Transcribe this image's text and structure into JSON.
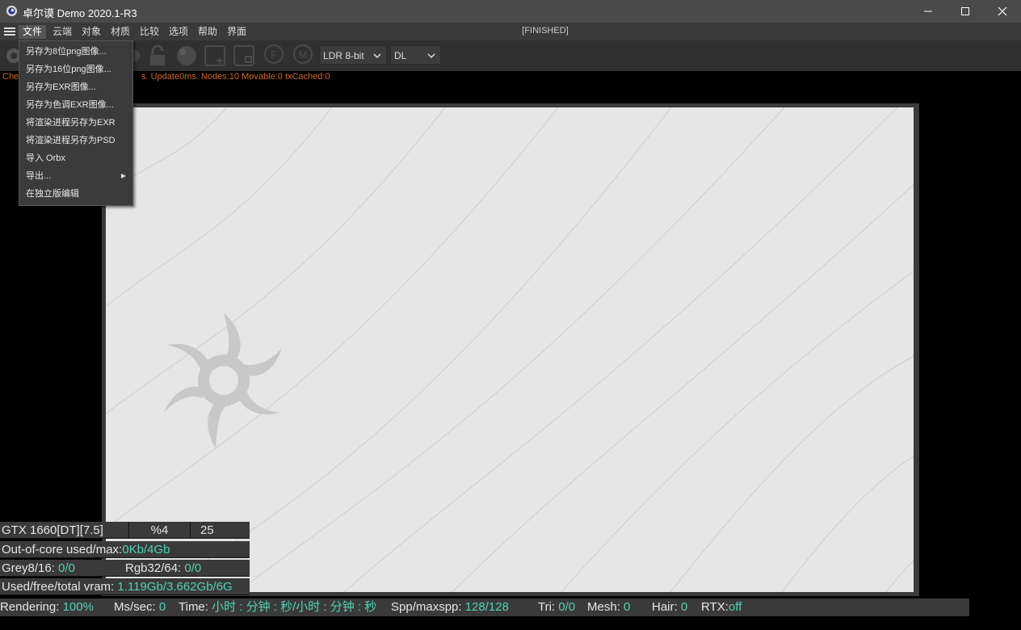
{
  "window": {
    "title": "卓尔谟 Demo 2020.1-R3"
  },
  "menubar": {
    "items": [
      "文件",
      "云端",
      "对象",
      "材质",
      "比较",
      "选项",
      "帮助",
      "界面"
    ],
    "status": "[FINISHED]"
  },
  "toolbar": {
    "ldr_select": "LDR 8-bit",
    "kernel_select": "DL"
  },
  "render_info": {
    "visible_text": "Che",
    "text": "s. Update0ms. Nodes:10 Movable:0 txCached:0"
  },
  "file_menu": {
    "items": [
      "另存为8位png图像...",
      "另存为16位png图像...",
      "另存为EXR图像...",
      "另存为色调EXR图像...",
      "将渲染进程另存为EXR",
      "将渲染进程另存为PSD",
      "导入 Orbx",
      "导出...",
      "在独立版编辑"
    ]
  },
  "gpu_panel": {
    "gpu": "GTX 1660[DT][7.5]",
    "percent": "%4",
    "temp": "25",
    "ooc_label": "Out-of-core used/max:",
    "ooc_value": "0Kb/4Gb",
    "grey_label": "Grey8/16: ",
    "grey_value": "0/0",
    "rgb_label": "Rgb32/64: ",
    "rgb_value": "0/0",
    "vram_label": "Used/free/total vram: ",
    "vram_value": "1.119Gb/3.662Gb/6G"
  },
  "bottom_status": {
    "rendering_label": "Rendering: ",
    "rendering_value": "100%",
    "mssec_label": "Ms/sec: ",
    "mssec_value": "0",
    "time_label": "Time: ",
    "time_value": "小时 : 分钟 : 秒/小时 : 分钟 : 秒",
    "spp_label": "Spp/maxspp: ",
    "spp_value": "128/128",
    "tri_label": "Tri: ",
    "tri_value": "0/0",
    "mesh_label": "Mesh: ",
    "mesh_value": "0",
    "hair_label": "Hair: ",
    "hair_value": "0",
    "rtx_label": "RTX:",
    "rtx_value": "off"
  },
  "colors": {
    "accent_value": "#4fd3b5",
    "status_orange": "#d4691e"
  }
}
